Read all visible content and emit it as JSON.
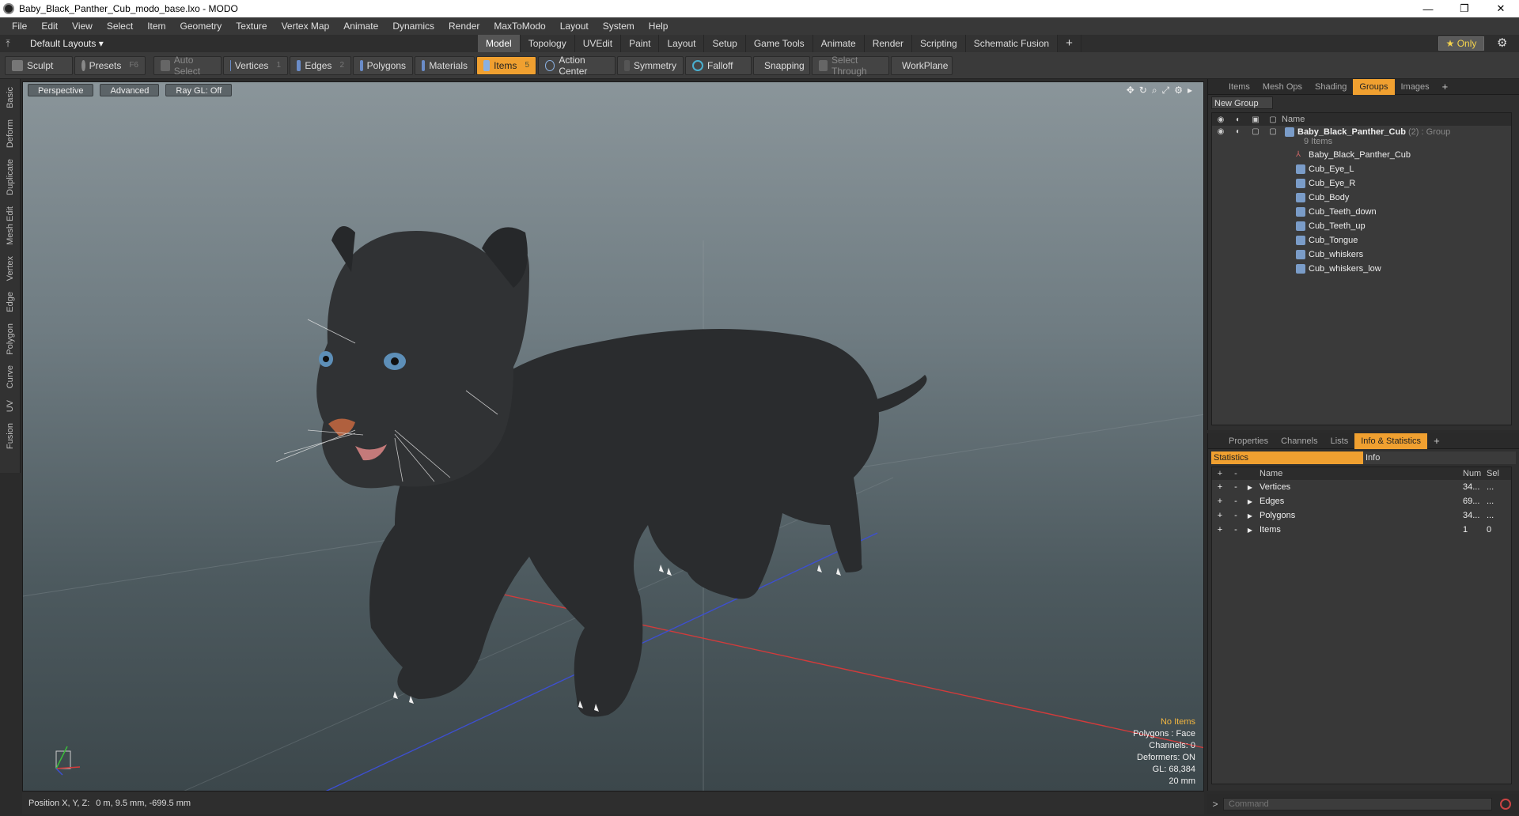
{
  "window": {
    "title": "Baby_Black_Panther_Cub_modo_base.lxo - MODO",
    "minimize": "—",
    "maximize": "❐",
    "close": "✕"
  },
  "menu": [
    "File",
    "Edit",
    "View",
    "Select",
    "Item",
    "Geometry",
    "Texture",
    "Vertex Map",
    "Animate",
    "Dynamics",
    "Render",
    "MaxToModo",
    "Layout",
    "System",
    "Help"
  ],
  "layoutbar": {
    "layout_name": "Default Layouts ▾",
    "tabs": [
      "Model",
      "Topology",
      "UVEdit",
      "Paint",
      "Layout",
      "Setup",
      "Game Tools",
      "Animate",
      "Render",
      "Scripting",
      "Schematic Fusion"
    ],
    "active_tab": "Model",
    "add": "+",
    "only_label": "★  Only"
  },
  "toolbar": {
    "sculpt": "Sculpt",
    "presets": "Presets",
    "presets_key": "F6",
    "auto_select": "Auto Select",
    "vertices": "Vertices",
    "vertices_count": "1",
    "edges": "Edges",
    "edges_count": "2",
    "polygons": "Polygons",
    "materials": "Materials",
    "items": "Items",
    "items_count": "5",
    "action_center": "Action Center",
    "symmetry": "Symmetry",
    "falloff": "Falloff",
    "snapping": "Snapping",
    "select_through": "Select Through",
    "workplane": "WorkPlane"
  },
  "lefttabs": [
    "Basic",
    "Deform",
    "Duplicate",
    "Mesh Edit",
    "Vertex",
    "Edge",
    "Polygon",
    "Curve",
    "UV",
    "Fusion"
  ],
  "viewport": {
    "view": "Perspective",
    "shading": "Advanced",
    "raygl": "Ray GL: Off",
    "hud": {
      "selection": "No Items",
      "polygons": "Polygons : Face",
      "channels": "Channels: 0",
      "deformers": "Deformers: ON",
      "gl": "GL: 68,384",
      "scale": "20 mm"
    }
  },
  "status": {
    "position_label": "Position X, Y, Z:",
    "position_value": "0 m, 9.5 mm, -699.5 mm"
  },
  "groups_panel": {
    "tabs": [
      "Items",
      "Mesh Ops",
      "Shading",
      "Groups",
      "Images"
    ],
    "active_tab": "Groups",
    "new_group": "New Group",
    "name_header": "Name",
    "group": {
      "name": "Baby_Black_Panther_Cub",
      "count": "(2)",
      "type": ": Group",
      "items_label": "9 Items"
    },
    "items": [
      "Baby_Black_Panther_Cub",
      "Cub_Eye_L",
      "Cub_Eye_R",
      "Cub_Body",
      "Cub_Teeth_down",
      "Cub_Teeth_up",
      "Cub_Tongue",
      "Cub_whiskers",
      "Cub_whiskers_low"
    ]
  },
  "stats_panel": {
    "tabs": [
      "Properties",
      "Channels",
      "Lists",
      "Info & Statistics"
    ],
    "active_tab": "Info & Statistics",
    "sub_tabs": [
      "Statistics",
      "Info"
    ],
    "headers": {
      "name": "Name",
      "num": "Num",
      "sel": "Sel"
    },
    "rows": [
      {
        "name": "Vertices",
        "num": "34...",
        "sel": "..."
      },
      {
        "name": "Edges",
        "num": "69...",
        "sel": "..."
      },
      {
        "name": "Polygons",
        "num": "34...",
        "sel": "..."
      },
      {
        "name": "Items",
        "num": "1",
        "sel": "0"
      }
    ]
  },
  "command": {
    "placeholder": "Command",
    "prompt": ">"
  }
}
